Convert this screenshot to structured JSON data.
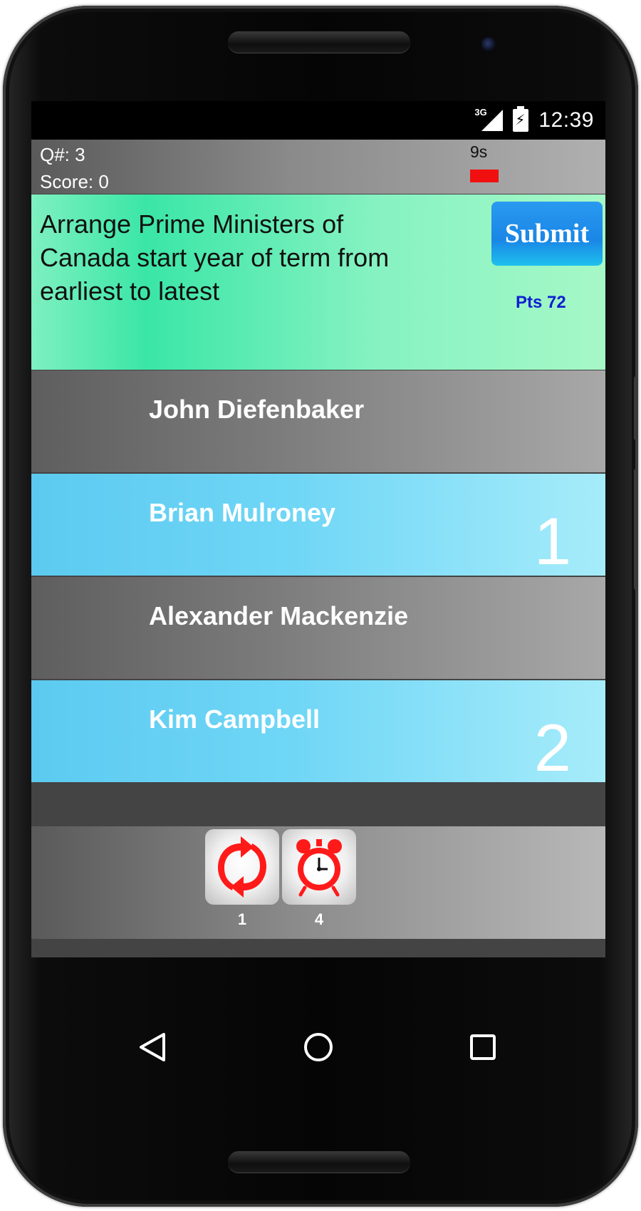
{
  "status_bar": {
    "network": "3G",
    "time": "12:39"
  },
  "header": {
    "question_number": "Q#: 3",
    "score": "Score: 0",
    "timer_seconds": "9s",
    "timer_fraction": 0.15
  },
  "question": {
    "text": "Arrange Prime Ministers of Canada start year of term from earliest to latest",
    "submit_label": "Submit",
    "points": "Pts 72"
  },
  "answers": [
    {
      "name": "John Diefenbaker",
      "rank": "",
      "selected": false
    },
    {
      "name": "Brian Mulroney",
      "rank": "1",
      "selected": true
    },
    {
      "name": "Alexander Mackenzie",
      "rank": "",
      "selected": false
    },
    {
      "name": "Kim Campbell",
      "rank": "2",
      "selected": true
    }
  ],
  "tools": [
    {
      "icon": "refresh-icon",
      "count": "1"
    },
    {
      "icon": "alarm-clock-icon",
      "count": "4"
    }
  ],
  "navigation": {
    "back_icon": "back-triangle-icon",
    "home_icon": "home-circle-icon",
    "recents_icon": "recents-square-icon"
  },
  "colors": {
    "timer_bar": "#f01010",
    "question_panel": "#3ae6a6",
    "submit_button": "#1a86e6",
    "points_text": "#1020d0",
    "selected_row": "#5ccaf0",
    "tool_icon": "#ff1a1a"
  }
}
